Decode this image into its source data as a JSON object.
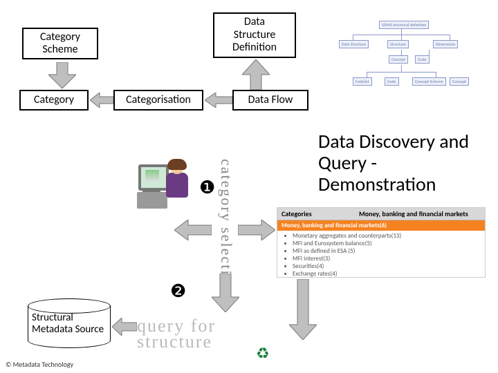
{
  "boxes": {
    "category_scheme": "Category\nScheme",
    "category": "Category",
    "categorisation": "Categorisation",
    "dsd": "Data\nStructure\nDefinition",
    "dataflow": "Data Flow"
  },
  "title": "Data Discovery and Query - Demonstration",
  "wordart": {
    "vertical": "category selection",
    "horizontal_line1": "query for",
    "horizontal_line2": "structure"
  },
  "cylinder": "Structural Metadata Source",
  "steps": {
    "one": "❶",
    "two": "❷"
  },
  "categories_panel": {
    "left_header": "Categories",
    "right_header": "Money, banking and financial markets",
    "selected": "Money, banking and financial markets(6)",
    "items": [
      "Monetary aggregates and counterparts(13)",
      "MFI and Eurosystem balance(5)",
      "MFI as defined in ESA (5)",
      "MFI interest(3)",
      "Securities(4)",
      "Exchange rates(4)"
    ]
  },
  "mini_chart": {
    "root": "SDMX structural definition",
    "row1": [
      "Data Structure",
      "Structure",
      "Dimensions"
    ],
    "mid": [
      "Concept"
    ],
    "row2a": [
      "Codelist",
      "Code"
    ],
    "row2b": [
      "Concept Scheme",
      "Concept"
    ]
  },
  "footer": "© Metadata Technology",
  "colors": {
    "arrow_fill": "#bfbfbf",
    "arrow_stroke": "#777777"
  }
}
